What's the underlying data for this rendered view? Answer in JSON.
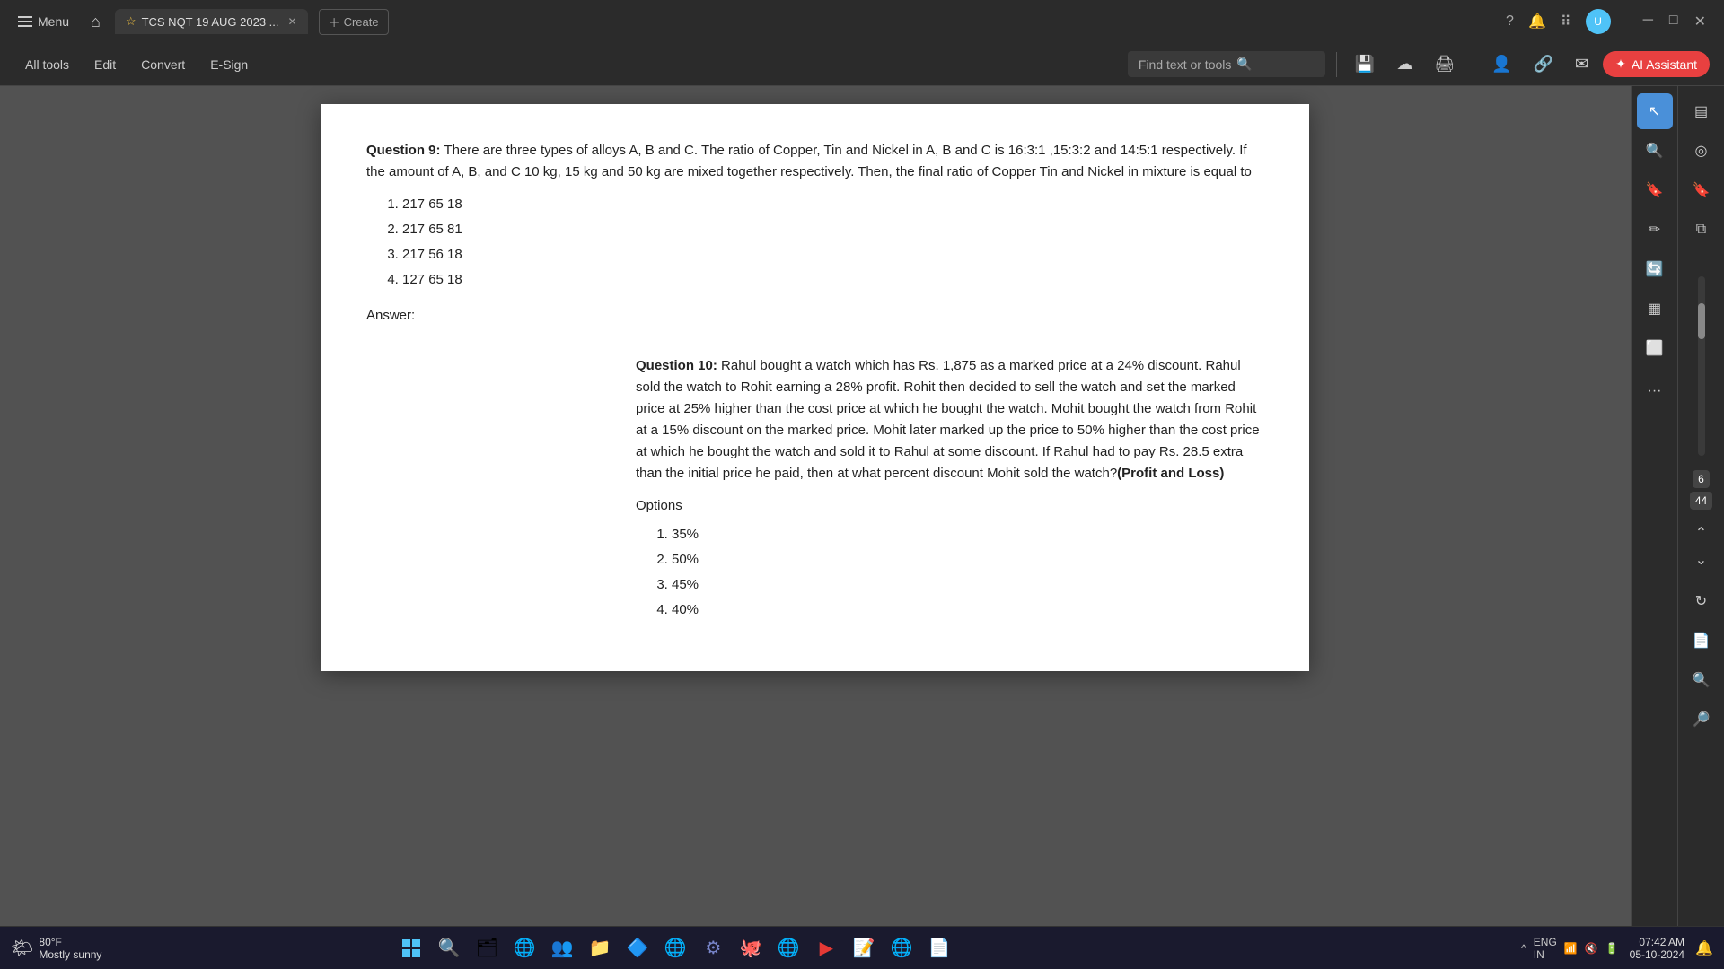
{
  "titlebar": {
    "menu_label": "Menu",
    "tab_title": "TCS NQT 19 AUG 2023 ...",
    "new_tab_label": "Create",
    "help_icon": "?",
    "avatar_initials": "U"
  },
  "toolbar": {
    "all_tools": "All tools",
    "edit": "Edit",
    "convert": "Convert",
    "esign": "E-Sign",
    "search_placeholder": "Find text or tools",
    "ai_btn_label": "AI Assistant"
  },
  "pdf": {
    "q9_label": "Question 9:",
    "q9_text": " There are three types of alloys A, B and C. The ratio of Copper, Tin and Nickel in A, B and C is 16:3:1 ,15:3:2 and 14:5:1 respectively. If the amount of  A, B, and C 10 kg, 15 kg and 50 kg are mixed together respectively. Then, the final ratio of Copper Tin and Nickel in mixture is equal to",
    "q9_options": [
      "217 65 18",
      "217 65 81",
      "217 56 18",
      "127 65 18"
    ],
    "answer_label": "Answer:",
    "q10_label": "Question 10:",
    "q10_text": " Rahul bought a watch which has Rs. 1,875 as a marked price at a 24% discount. Rahul sold the watch to Rohit earning a 28% profit. Rohit then decided to sell the watch and set the marked price at 25% higher than the cost price at which he bought the watch. Mohit bought the watch from Rohit at a 15% discount on the marked price. Mohit later marked up the price to 50% higher than the cost price at which he bought the watch and sold it to Rahul at some discount. If Rahul had to pay Rs. 28.5 extra than the initial price he paid, then at what percent discount Mohit sold the watch?",
    "q10_tag": "(Profit and Loss)",
    "options_label": "Options",
    "q10_options": [
      "35%",
      "50%",
      "45%",
      "40%"
    ]
  },
  "page_info": {
    "current_page": "6",
    "total_pages": "44"
  },
  "taskbar": {
    "weather_temp": "80°F",
    "weather_condition": "Mostly sunny",
    "language": "ENG\nIN",
    "time": "07:42 AM",
    "date": "05-10-2024"
  }
}
